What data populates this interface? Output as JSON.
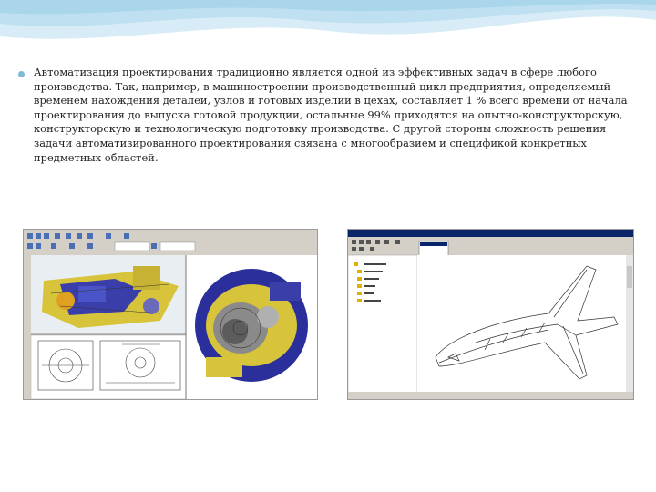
{
  "slide": {
    "paragraph": "Автоматизация проектирования традиционно является одной из эффективных задач в сфере любого производства. Так, например, в машиностроении производственный цикл предприятия, определяемый временем нахождения деталей, узлов и готовых изделий в цехах, составляет 1 % всего времени от начала проектирования до выпуска готовой продукции, остальные 99% приходятся на опытно-конструкторскую, конструкторскую и технологическую подготовку производства. С другой стороны сложность решения задачи автоматизированного проектирования связана с многообразием и спецификой конкретных предметных областей."
  },
  "colors": {
    "accent_wave": "#a9d6ea",
    "bullet": "#7fb9d6",
    "cad_model_yellow": "#d8c43a",
    "cad_model_blue": "#3a3ea8",
    "cad_toolbar": "#d4d0c8"
  },
  "images": [
    {
      "name": "cad-mechanical-assembly-screenshot"
    },
    {
      "name": "cad-space-shuttle-wireframe-screenshot"
    }
  ]
}
